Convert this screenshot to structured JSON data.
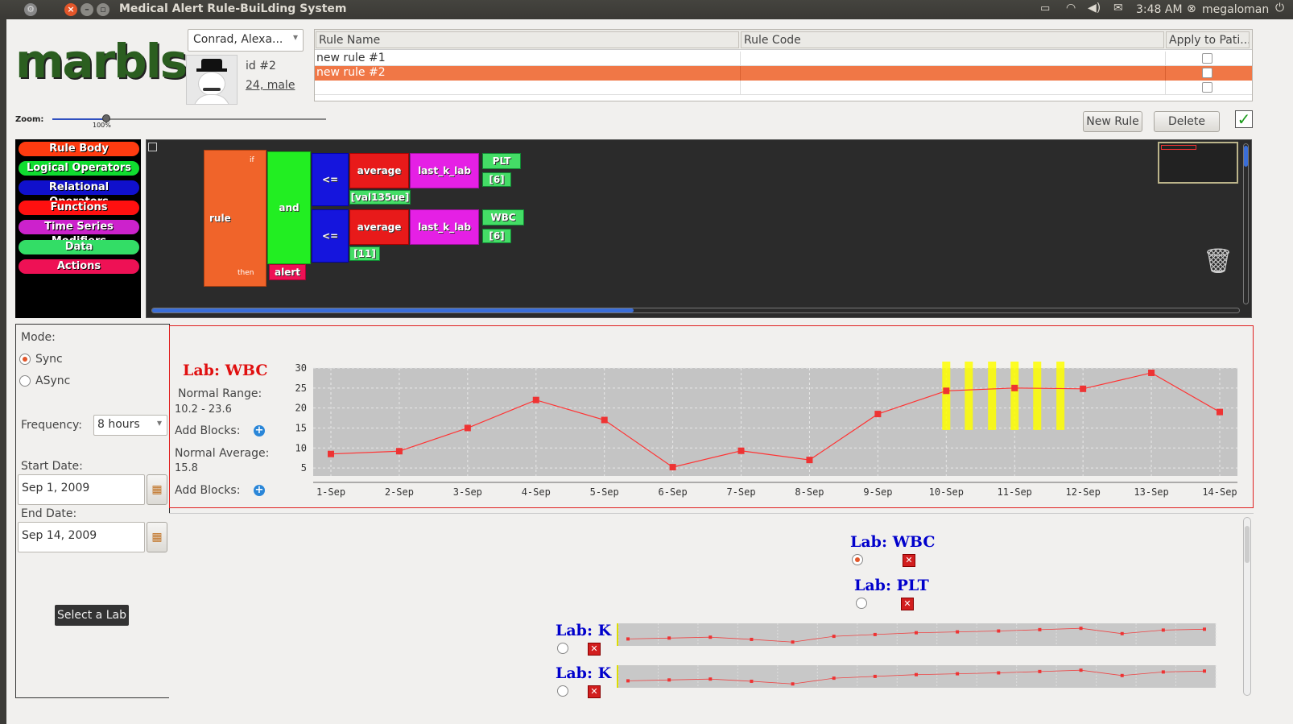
{
  "window": {
    "title": "Medical Alert Rule-BuiLding System"
  },
  "topbar": {
    "time": "3:48 AM",
    "user": "megaloman"
  },
  "app": {
    "logo": "marbls",
    "zoom_label": "Zoom:",
    "zoom_value": "100%"
  },
  "patient": {
    "selected": "Conrad, Alexa...",
    "id": "id #2",
    "info": "24, male"
  },
  "rules_table": {
    "headers": [
      "Rule Name",
      "Rule Code",
      "Apply to Pati..."
    ],
    "rows": [
      {
        "name": "new rule #1",
        "code": "",
        "checked": false
      },
      {
        "name": "new rule #2",
        "code": "",
        "checked": false
      },
      {
        "name": "",
        "code": "",
        "checked": false
      }
    ]
  },
  "buttons": {
    "new_rule": "New Rule",
    "delete": "Delete",
    "select_lab": "Select a Lab"
  },
  "categories": [
    {
      "label": "Rule Body",
      "color": "#ff3300"
    },
    {
      "label": "Logical Operators",
      "color": "#00cc33"
    },
    {
      "label": "Relational Operators",
      "color": "#0000cc"
    },
    {
      "label": "Functions",
      "color": "#ff0000"
    },
    {
      "label": "Time Series Modifiers",
      "color": "#cc33cc"
    },
    {
      "label": "Data",
      "color": "#33cc66"
    },
    {
      "label": "Actions",
      "color": "#ee1155"
    }
  ],
  "blocks": {
    "rule": "rule",
    "if": "if",
    "then": "then",
    "and": "and",
    "le1": "<=",
    "le2": "<=",
    "avg1": "average",
    "avg2": "average",
    "lkl1": "last_k_lab",
    "lkl2": "last_k_lab",
    "plt": "PLT",
    "wbc": "WBC",
    "k1": "[6]",
    "k2": "[6]",
    "val1": "[val135ue]",
    "val2": "[11]",
    "alert": "alert"
  },
  "controls": {
    "mode_label": "Mode:",
    "sync": "Sync",
    "async": "ASync",
    "mode": "Sync",
    "frequency_label": "Frequency:",
    "frequency": "8 hours",
    "start_label": "Start Date:",
    "start_date": "Sep 1, 2009",
    "end_label": "End Date:",
    "end_date": "Sep 14, 2009"
  },
  "main_chart": {
    "lab_title": "Lab: WBC",
    "normal_range_label": "Normal Range:",
    "normal_range": "10.2 - 23.6",
    "add_blocks_1": "Add Blocks:",
    "normal_average_label": "Normal Average:",
    "normal_average": "15.8",
    "add_blocks_2": "Add Blocks:"
  },
  "chart_data": {
    "type": "line",
    "title": "Lab: WBC",
    "categories": [
      "1-Sep",
      "2-Sep",
      "3-Sep",
      "4-Sep",
      "5-Sep",
      "6-Sep",
      "7-Sep",
      "8-Sep",
      "9-Sep",
      "10-Sep",
      "11-Sep",
      "12-Sep",
      "13-Sep",
      "14-Sep"
    ],
    "values": [
      8.5,
      9.2,
      15,
      22,
      17,
      5.2,
      9.3,
      7,
      18.5,
      24.3,
      25,
      24.8,
      28.8,
      19
    ],
    "ylim": [
      3,
      30
    ],
    "yticks": [
      5,
      10,
      15,
      20,
      25,
      30
    ],
    "highlight_x": [
      10,
      10.33,
      10.67,
      11,
      11.33,
      11.67
    ],
    "highlight_range": [
      14.5,
      30
    ],
    "line_color": "#ff3333",
    "highlight_color": "#ffff00",
    "grid": true
  },
  "lab_list": [
    {
      "title": "Lab: WBC",
      "color": "#0000cc",
      "selected": true
    },
    {
      "title": "Lab: PLT",
      "color": "#0000cc",
      "selected": false
    },
    {
      "title": "Lab: K",
      "color": "#0000cc",
      "selected": false
    },
    {
      "title": "Lab: K",
      "color": "#0000cc",
      "selected": false
    }
  ],
  "mini_values": [
    3.2,
    3.4,
    3.6,
    3.1,
    2.5,
    3.8,
    4.2,
    4.6,
    4.8,
    5.0,
    5.3,
    5.6,
    4.4,
    5.2,
    5.4
  ]
}
